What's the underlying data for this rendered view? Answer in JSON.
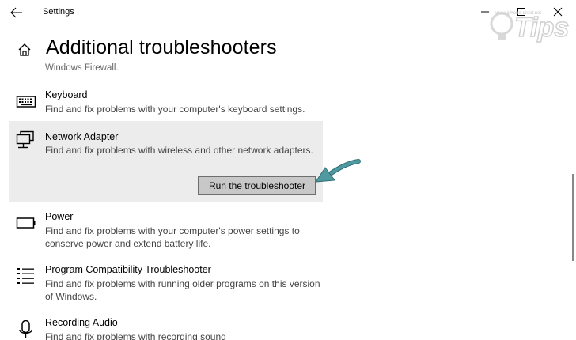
{
  "window": {
    "app_title": "Settings"
  },
  "page": {
    "title": "Additional troubleshooters"
  },
  "list": {
    "clipped_text": "Windows Firewall.",
    "items": [
      {
        "name": "Keyboard",
        "desc": "Find and fix problems with your computer's keyboard settings.",
        "icon": "keyboard-icon"
      },
      {
        "name": "Network Adapter",
        "desc": "Find and fix problems with wireless and other network adapters.",
        "icon": "network-icon",
        "selected": true,
        "button_label": "Run the troubleshooter"
      },
      {
        "name": "Power",
        "desc": "Find and fix problems with your computer's power settings to conserve power and extend battery life.",
        "icon": "battery-icon"
      },
      {
        "name": "Program Compatibility Troubleshooter",
        "desc": "Find and fix problems with running older programs on this version of Windows.",
        "icon": "list-icon"
      },
      {
        "name": "Recording Audio",
        "desc": "Find and fix problems with recording sound",
        "icon": "microphone-icon"
      }
    ]
  },
  "watermark": {
    "text": "Tips",
    "small_text": "www.iphone-droid.net"
  },
  "colors": {
    "selected_bg": "#ececec",
    "button_bg": "#c8c8c8",
    "arrow": "#3f8a8e"
  }
}
